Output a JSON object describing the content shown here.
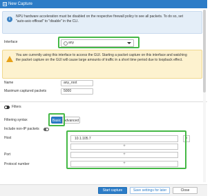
{
  "window": {
    "title": "New Capture"
  },
  "info": {
    "text": "NPU hardware acceleration must be disabled on the respective firewall policy to see all packets. To do so, set \"auto-asic-offload\" to \"disable\" in the CLI."
  },
  "interface": {
    "label": "Interface",
    "value": "any"
  },
  "warning": {
    "text": "You are currently using this interface to access the GUI. Starting a packet capture on this interface and watching the packet capture on the GUI will cause large amounts of traffic in a short time period due to loopback effect."
  },
  "name": {
    "label": "Name",
    "value": "any_root"
  },
  "max_packets": {
    "label": "Maximum captured packets",
    "value": "5000"
  },
  "filters": {
    "label": "Filters",
    "syntax_label": "Filtering syntax",
    "basic_label": "Basic",
    "advanced_label": "Advanced",
    "non_ip_label": "Include non-IP packets",
    "host_label": "Host",
    "host_value": "10.1.105.7",
    "add_symbol": "+",
    "remove_symbol": "×",
    "port_label": "Port",
    "protocol_label": "Protocol number"
  },
  "footer": {
    "start_label": "Start capture",
    "save_label": "Save settings for later",
    "close_label": "Close"
  },
  "colors": {
    "accent": "#2c7cc7",
    "highlight": "#44b845",
    "warning_bg": "#fdf2cf",
    "info_bg": "#e4eef8"
  }
}
